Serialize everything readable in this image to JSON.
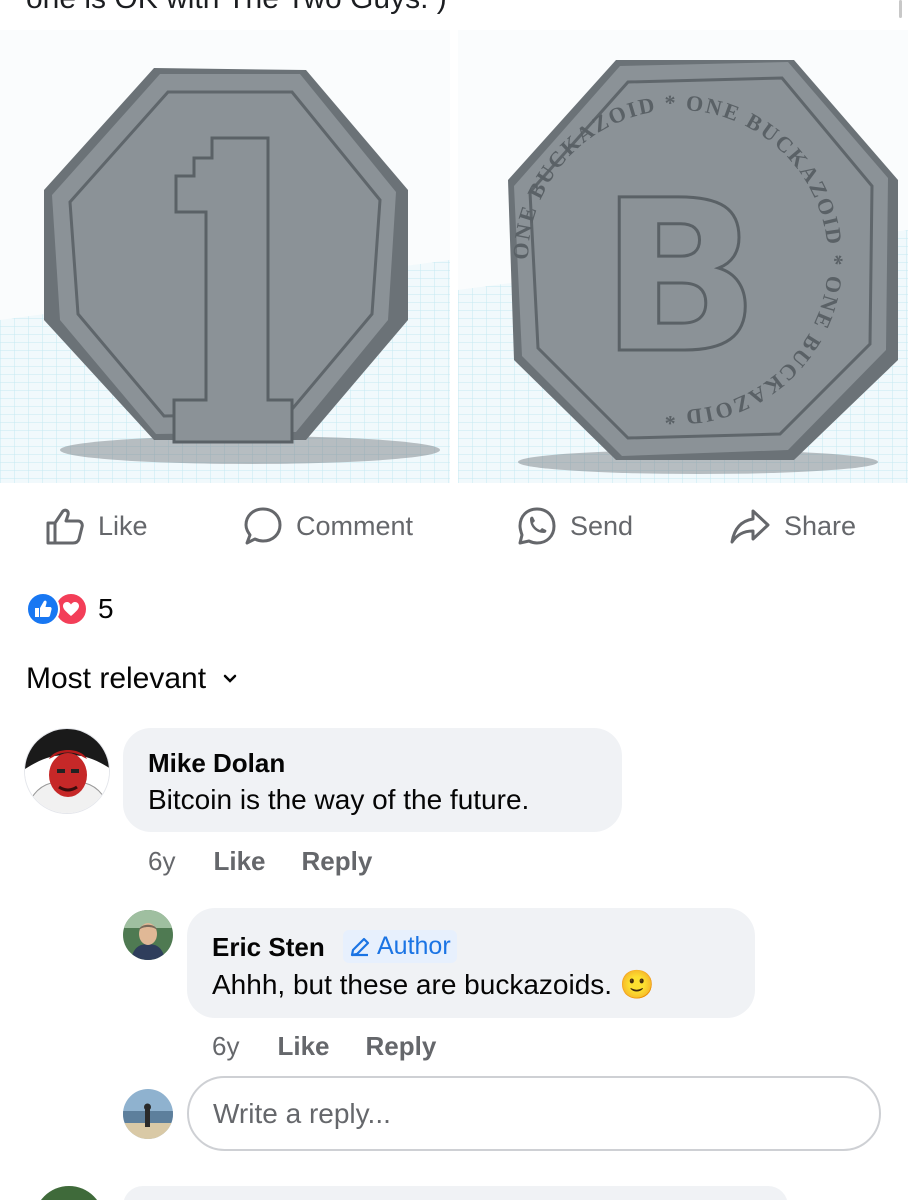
{
  "post": {
    "caption_fragment": "one is OK with The Two Guys. )"
  },
  "coins": {
    "left_numeral": "1",
    "right_letter": "B",
    "right_ring_text": "ONE BUCKAZOID * ONE BUCKAZOID * ONE BUCKAZOID *"
  },
  "actions": {
    "like": "Like",
    "comment": "Comment",
    "send": "Send",
    "share": "Share"
  },
  "reactions": {
    "count": "5",
    "types": [
      "like-icon",
      "love-icon"
    ]
  },
  "sort": {
    "label": "Most relevant"
  },
  "comments": [
    {
      "author": "Mike Dolan",
      "text": "Bitcoin is the way of the future.",
      "time": "6y",
      "like_label": "Like",
      "reply_label": "Reply"
    }
  ],
  "replies": [
    {
      "author": "Eric Sten",
      "badge": "Author",
      "text": "Ahhh, but these are buckazoids. 🙂",
      "time": "6y",
      "like_label": "Like",
      "reply_label": "Reply"
    }
  ],
  "reply_box": {
    "placeholder": "Write a reply..."
  },
  "colors": {
    "accent": "#1877f2",
    "love": "#f33e58",
    "meta_gray": "#65676b",
    "bubble_bg": "#f0f2f5",
    "coin_gray": "#8b9297",
    "grid_blue": "#b9e6f2"
  }
}
